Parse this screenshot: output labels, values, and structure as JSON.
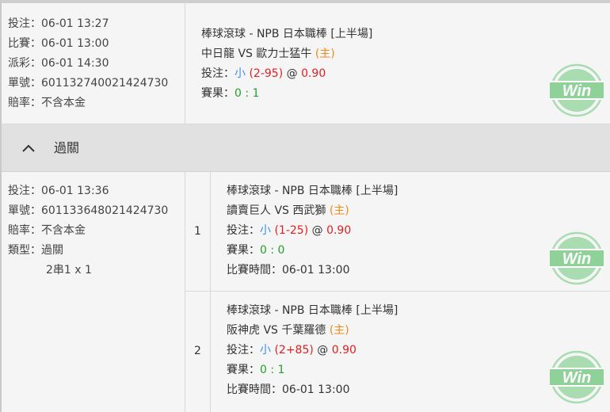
{
  "single_bet": {
    "meta": [
      {
        "label": "投注：",
        "value": "06-01 13:27"
      },
      {
        "label": "比賽：",
        "value": "06-01 13:00"
      },
      {
        "label": "派彩：",
        "value": "06-01 14:30"
      },
      {
        "label": "單號：",
        "value": "601132740021424730"
      },
      {
        "label": "賠率：",
        "value": "不含本金"
      }
    ],
    "league": "棒球滾球 - NPB 日本職棒 [上半場]",
    "home_team": "中日龍",
    "vs": " VS ",
    "away_team": "歐力士猛牛",
    "home_marker": "(主)",
    "bet_label": "投注：",
    "selection": "小",
    "handicap": "(2-95)",
    "at": "@",
    "odds": "0.90",
    "result_label": "賽果：",
    "score": "0 : 1",
    "badge": "Win"
  },
  "parlay_section": {
    "title": "過關"
  },
  "parlay_bet": {
    "meta": [
      {
        "label": "投注：",
        "value": "06-01 13:36"
      },
      {
        "label": "單號：",
        "value": "601133648021424730"
      },
      {
        "label": "賠率：",
        "value": "不含本金"
      },
      {
        "label": "類型：",
        "value": "過關"
      }
    ],
    "combo": "2串1 x 1",
    "legs": [
      {
        "number": "1",
        "league": "棒球滾球 - NPB 日本職棒 [上半場]",
        "home_team": "讀賣巨人",
        "vs": " VS ",
        "away_team": "西武獅",
        "home_marker": "(主)",
        "bet_label": "投注：",
        "selection": "小",
        "handicap": "(1-25)",
        "at": "@",
        "odds": "0.90",
        "result_label": "賽果：",
        "score": "0 : 0",
        "time_label": "比賽時間：",
        "time": "06-01 13:00",
        "badge": "Win"
      },
      {
        "number": "2",
        "league": "棒球滾球 - NPB 日本職棒 [上半場]",
        "home_team": "阪神虎",
        "vs": " VS ",
        "away_team": "千葉羅德",
        "home_marker": "(主)",
        "bet_label": "投注：",
        "selection": "小",
        "handicap": "(2+85)",
        "at": "@",
        "odds": "0.90",
        "result_label": "賽果：",
        "score": "0 : 1",
        "time_label": "比賽時間：",
        "time": "06-01 13:00",
        "badge": "Win"
      }
    ]
  },
  "colors": {
    "selection": "#3b8fe6",
    "handicap_and_odds": "#e02020",
    "home_marker": "#ef8a16",
    "score": "#22a12f",
    "win_badge": "#8fd199"
  }
}
